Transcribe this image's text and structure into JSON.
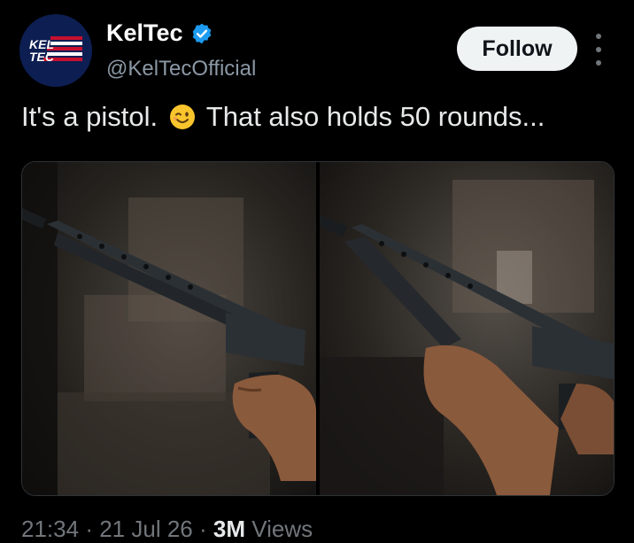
{
  "account": {
    "name": "KelTec",
    "handle": "@KelTecOfficial",
    "avatar_text_top": "KEL",
    "avatar_text_bottom": "TEC",
    "verified": true,
    "verified_color": "#1d9bf0",
    "avatar_bg": "#0d1e52"
  },
  "actions": {
    "follow_label": "Follow",
    "more_icon": "more-vertical-icon"
  },
  "tweet": {
    "text_before_emoji": "It's a pistol.",
    "emoji": "winking-face",
    "text_after_emoji": "That also holds 50 rounds...",
    "media": [
      {
        "alt": "hand gripping pistol with rear grip",
        "icon": "photo"
      },
      {
        "alt": "two hands holding pistol by magazine and grip",
        "icon": "photo"
      }
    ]
  },
  "meta": {
    "time": "21:34",
    "separator": "·",
    "date": "21 Jul 26",
    "views_count": "3M",
    "views_label": "Views"
  },
  "colors": {
    "background": "#000000",
    "text": "#e7e9ea",
    "secondary_text": "#71767b",
    "follow_bg": "#eff3f4"
  }
}
